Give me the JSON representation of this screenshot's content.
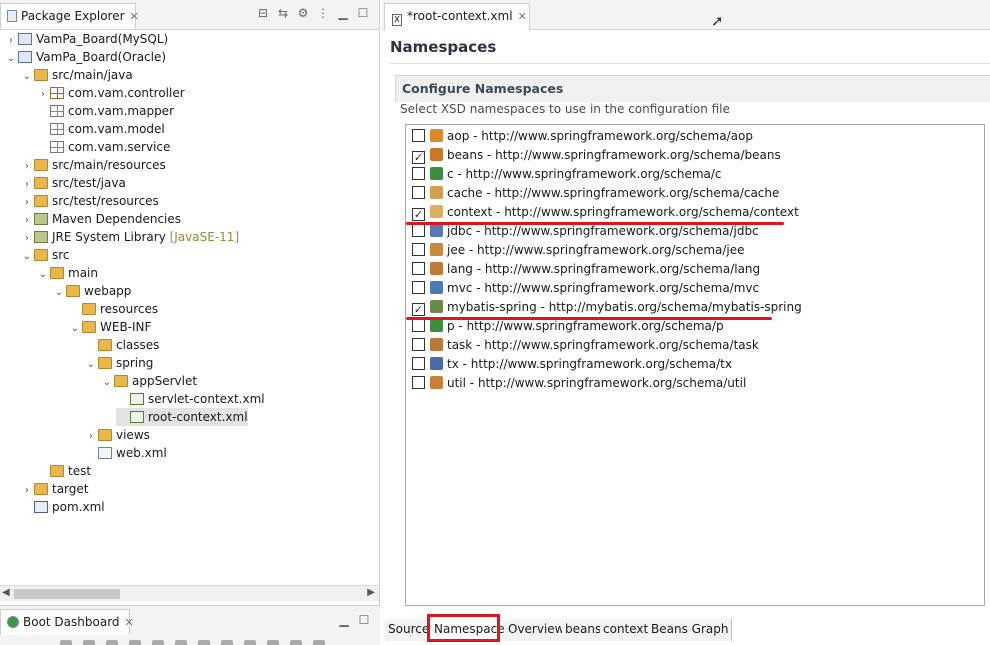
{
  "left_panel": {
    "tab_label": "Package Explorer",
    "tree": [
      {
        "label": "VamPa_Board(MySQL)",
        "icon": "project-icon",
        "expanded": false
      },
      {
        "label": "VamPa_Board(Oracle)",
        "icon": "project-icon",
        "expanded": true
      },
      {
        "label": "src/main/java",
        "icon": "source-folder-icon",
        "expanded": true
      },
      {
        "label": "com.vam.controller",
        "icon": "package-icon",
        "expanded": false
      },
      {
        "label": "com.vam.mapper",
        "icon": "empty-package-icon"
      },
      {
        "label": "com.vam.model",
        "icon": "empty-package-icon"
      },
      {
        "label": "com.vam.service",
        "icon": "empty-package-icon"
      },
      {
        "label": "src/main/resources",
        "icon": "source-folder-icon",
        "expanded": false
      },
      {
        "label": "src/test/java",
        "icon": "source-folder-icon",
        "expanded": false
      },
      {
        "label": "src/test/resources",
        "icon": "source-folder-icon",
        "expanded": false
      },
      {
        "label": "Maven Dependencies",
        "icon": "library-icon",
        "expanded": false
      },
      {
        "label": "JRE System Library",
        "suffix": "[JavaSE-11]",
        "icon": "library-icon",
        "expanded": false
      },
      {
        "label": "src",
        "icon": "folder-icon",
        "expanded": true
      },
      {
        "label": "main",
        "icon": "folder-icon",
        "expanded": true
      },
      {
        "label": "webapp",
        "icon": "folder-icon",
        "expanded": true
      },
      {
        "label": "resources",
        "icon": "folder-icon"
      },
      {
        "label": "WEB-INF",
        "icon": "folder-icon",
        "expanded": true
      },
      {
        "label": "classes",
        "icon": "folder-icon"
      },
      {
        "label": "spring",
        "icon": "folder-icon",
        "expanded": true
      },
      {
        "label": "appServlet",
        "icon": "folder-icon",
        "expanded": true
      },
      {
        "label": "servlet-context.xml",
        "icon": "spring-xml-icon"
      },
      {
        "label": "root-context.xml",
        "icon": "spring-xml-icon",
        "selected": true
      },
      {
        "label": "views",
        "icon": "folder-icon",
        "expanded": false
      },
      {
        "label": "web.xml",
        "icon": "xml-file-icon"
      },
      {
        "label": "test",
        "icon": "folder-icon"
      },
      {
        "label": "target",
        "icon": "folder-icon",
        "expanded": false
      },
      {
        "label": "pom.xml",
        "icon": "maven-pom-icon"
      }
    ],
    "bottom_tab_label": "Boot Dashboard"
  },
  "editor": {
    "tab_label": "*root-context.xml",
    "page_title": "Namespaces",
    "section_title": "Configure Namespaces",
    "section_description": "Select XSD namespaces to use in the configuration file",
    "namespaces": [
      {
        "label": "aop - http://www.springframework.org/schema/aop",
        "checked": false,
        "icon_color": "#d98a2b"
      },
      {
        "label": "beans - http://www.springframework.org/schema/beans",
        "checked": true,
        "icon_color": "#c9772a"
      },
      {
        "label": "c - http://www.springframework.org/schema/c",
        "checked": false,
        "icon_color": "#3c8f3c"
      },
      {
        "label": "cache - http://www.springframework.org/schema/cache",
        "checked": false,
        "icon_color": "#d0a050"
      },
      {
        "label": "context - http://www.springframework.org/schema/context",
        "checked": true,
        "icon_color": "#d8b060"
      },
      {
        "label": "jdbc - http://www.springframework.org/schema/jdbc",
        "checked": false,
        "icon_color": "#5a78b8"
      },
      {
        "label": "jee - http://www.springframework.org/schema/jee",
        "checked": false,
        "icon_color": "#c88a3a"
      },
      {
        "label": "lang - http://www.springframework.org/schema/lang",
        "checked": false,
        "icon_color": "#c07a3a"
      },
      {
        "label": "mvc - http://www.springframework.org/schema/mvc",
        "checked": false,
        "icon_color": "#4a7ab8"
      },
      {
        "label": "mybatis-spring - http://mybatis.org/schema/mybatis-spring",
        "checked": true,
        "icon_color": "#6a8a4a"
      },
      {
        "label": "p - http://www.springframework.org/schema/p",
        "checked": false,
        "icon_color": "#3c8f3c"
      },
      {
        "label": "task - http://www.springframework.org/schema/task",
        "checked": false,
        "icon_color": "#b8783a"
      },
      {
        "label": "tx - http://www.springframework.org/schema/tx",
        "checked": false,
        "icon_color": "#4a6aa8"
      },
      {
        "label": "util - http://www.springframework.org/schema/util",
        "checked": false,
        "icon_color": "#c8803a"
      }
    ],
    "bottom_tabs": [
      "Source",
      "Namespace",
      "Overview",
      "beans",
      "context",
      "Beans Graph"
    ],
    "active_bottom_tab": "Namespace",
    "highlight_color": "#e0141e"
  }
}
